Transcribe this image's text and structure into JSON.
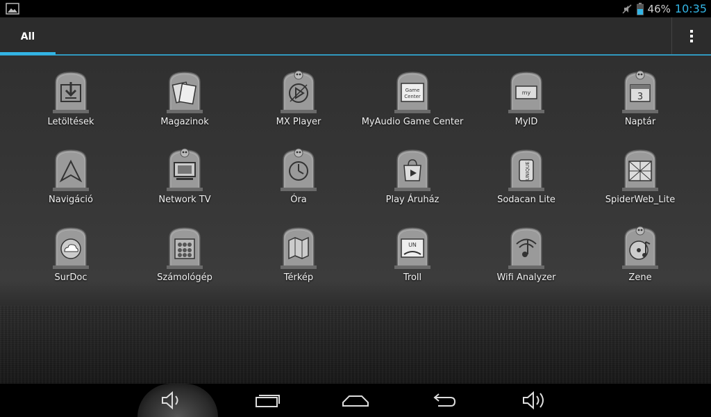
{
  "status_bar": {
    "battery_percent": "46%",
    "time": "10:35",
    "icons": [
      "gallery-icon",
      "mute-icon",
      "battery-icon"
    ]
  },
  "tabs": [
    {
      "label": "All",
      "selected": true
    }
  ],
  "apps": [
    {
      "label": "Letöltések",
      "icon": "download-icon"
    },
    {
      "label": "Magazinok",
      "icon": "magazines-icon"
    },
    {
      "label": "MX Player",
      "icon": "play-icon"
    },
    {
      "label": "MyAudio Game Center",
      "icon": "game-center-icon"
    },
    {
      "label": "MyID",
      "icon": "myid-icon"
    },
    {
      "label": "Naptár",
      "icon": "calendar-icon"
    },
    {
      "label": "Navigáció",
      "icon": "navigation-icon"
    },
    {
      "label": "Network TV",
      "icon": "tv-icon"
    },
    {
      "label": "Óra",
      "icon": "clock-icon"
    },
    {
      "label": "Play Áruház",
      "icon": "play-store-icon"
    },
    {
      "label": "Sodacan Lite",
      "icon": "soda-can-icon"
    },
    {
      "label": "SpiderWeb_Lite",
      "icon": "spider-web-icon"
    },
    {
      "label": "SurDoc",
      "icon": "cloud-icon"
    },
    {
      "label": "Számológép",
      "icon": "calculator-icon"
    },
    {
      "label": "Térkép",
      "icon": "map-icon"
    },
    {
      "label": "Troll",
      "icon": "troll-icon"
    },
    {
      "label": "Wifi Analyzer",
      "icon": "wifi-icon"
    },
    {
      "label": "Zene",
      "icon": "music-icon"
    }
  ],
  "colors": {
    "accent": "#33b5e5",
    "tombstone": "#9a9a9a"
  }
}
